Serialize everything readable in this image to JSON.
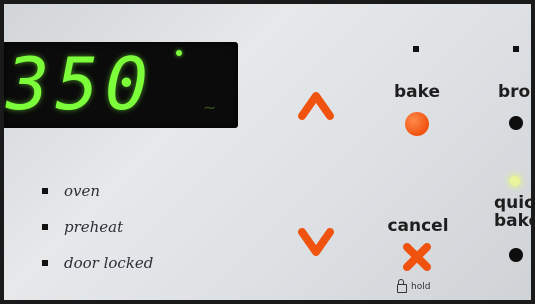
{
  "display": {
    "temperature": "350"
  },
  "indicators": [
    {
      "label": "oven"
    },
    {
      "label": "preheat"
    },
    {
      "label": "door locked"
    }
  ],
  "buttons": {
    "bake": "bake",
    "broil": "broil",
    "cancel": "cancel",
    "quick_bake_line1": "quick",
    "quick_bake_line2": "bake",
    "hold": "hold"
  },
  "colors": {
    "display_digits": "#7cff3a",
    "button_orange": "#f0520f",
    "panel": "#dfe2e5"
  },
  "icons": {
    "up": "chevron-up-icon",
    "down": "chevron-down-icon",
    "cancel": "x-icon",
    "lock": "lock-icon"
  }
}
